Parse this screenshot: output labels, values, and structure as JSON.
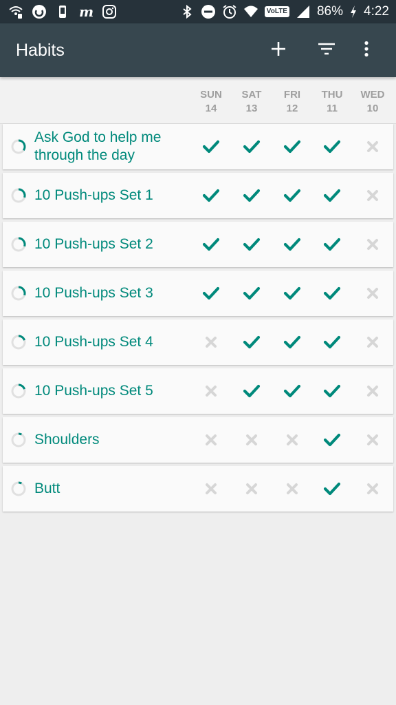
{
  "status_bar": {
    "battery": "86%",
    "time": "4:22",
    "network_badge": "VoLTE",
    "icons_left": [
      "wifi-calling-icon",
      "messenger-icon",
      "phone-icon",
      "m-app-icon",
      "instagram-icon"
    ],
    "icons_right": [
      "bluetooth-icon",
      "dnd-icon",
      "alarm-icon",
      "wifi-icon",
      "volte-icon",
      "signal-icon",
      "charging-icon"
    ]
  },
  "app_bar": {
    "title": "Habits",
    "actions": [
      "add-icon",
      "filter-icon",
      "more-icon"
    ]
  },
  "days": [
    {
      "name": "SUN",
      "date": "14"
    },
    {
      "name": "SAT",
      "date": "13"
    },
    {
      "name": "FRI",
      "date": "12"
    },
    {
      "name": "THU",
      "date": "11"
    },
    {
      "name": "WED",
      "date": "10"
    }
  ],
  "colors": {
    "accent": "#00897b",
    "app_bar": "#37474f",
    "status_bar": "#26323a",
    "unchecked": "#d6d6d6"
  },
  "habits": [
    {
      "name": "Ask God to help me through the day",
      "score": 0.35,
      "checks": [
        true,
        true,
        true,
        true,
        false
      ]
    },
    {
      "name": "10 Push-ups Set 1",
      "score": 0.3,
      "checks": [
        true,
        true,
        true,
        true,
        false
      ]
    },
    {
      "name": "10 Push-ups Set 2",
      "score": 0.3,
      "checks": [
        true,
        true,
        true,
        true,
        false
      ]
    },
    {
      "name": "10 Push-ups Set 3",
      "score": 0.3,
      "checks": [
        true,
        true,
        true,
        true,
        false
      ]
    },
    {
      "name": "10 Push-ups Set 4",
      "score": 0.2,
      "checks": [
        false,
        true,
        true,
        true,
        false
      ]
    },
    {
      "name": "10 Push-ups Set 5",
      "score": 0.2,
      "checks": [
        false,
        true,
        true,
        true,
        false
      ]
    },
    {
      "name": "Shoulders",
      "score": 0.08,
      "checks": [
        false,
        false,
        false,
        true,
        false
      ]
    },
    {
      "name": "Butt",
      "score": 0.08,
      "checks": [
        false,
        false,
        false,
        true,
        false
      ]
    }
  ]
}
